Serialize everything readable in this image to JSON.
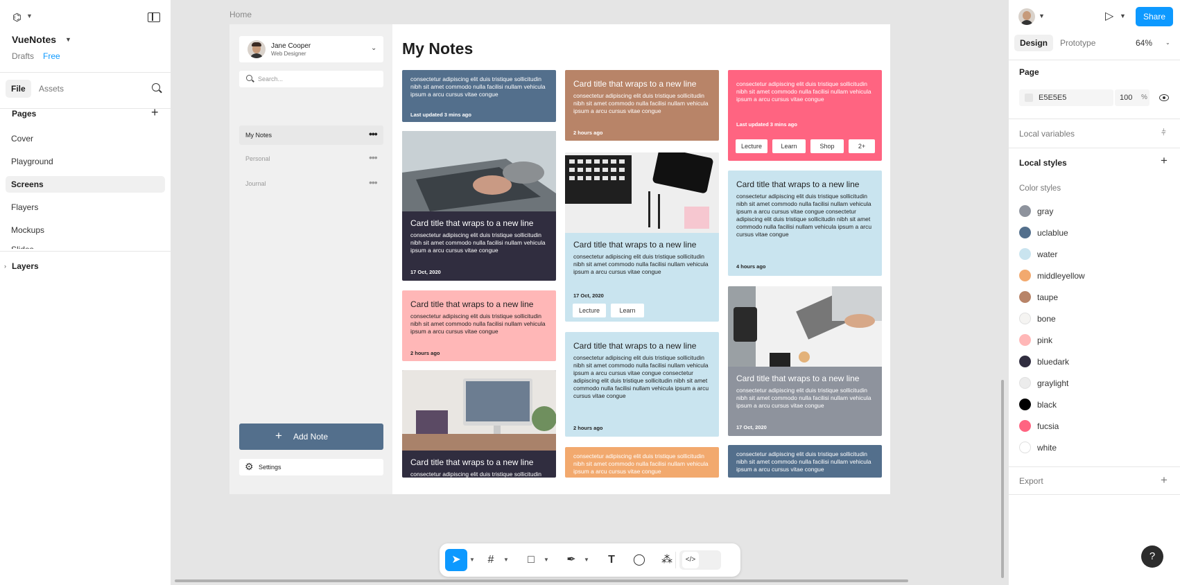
{
  "left_panel": {
    "project_name": "VueNotes",
    "drafts_label": "Drafts",
    "plan_label": "Free",
    "tabs": [
      "File",
      "Assets"
    ],
    "pages_header": "Pages",
    "pages": [
      "Cover",
      "Playground",
      "Screens",
      "Flayers",
      "Mockups"
    ],
    "pages_partial": "Slides",
    "selected_page": "Screens",
    "layers_label": "Layers"
  },
  "canvas": {
    "frame_label": "Home"
  },
  "app": {
    "user_name": "Jane Cooper",
    "user_role": "Web Designer",
    "search_placeholder": "Search...",
    "nav": [
      "My Notes",
      "Personal",
      "Journal"
    ],
    "add_note_label": "Add Note",
    "settings_label": "Settings",
    "title": "My Notes",
    "card_title": "Card title that wraps to a new line",
    "body_short": "consectetur adipiscing elit duis tristique sollicitudin nibh sit amet commodo nulla facilisi nullam vehicula ipsum a arcu cursus vitae congue",
    "body_long": "consectetur adipiscing elit duis tristique sollicitudin nibh sit amet commodo nulla facilisi nullam vehicula ipsum a arcu cursus vitae congue consectetur adipiscing elit duis tristique sollicitudin nibh sit amet commodo nulla facilisi nullam vehicula ipsum a arcu cursus vitae congue",
    "date_updated": "Last updated 3 mins ago",
    "date_2h": "2 hours ago",
    "date_4h": "4 hours ago",
    "date_oct": "17 Oct, 2020",
    "tags_a": [
      "Lecture",
      "Learn",
      "Shop",
      "2+"
    ],
    "tags_b": [
      "Lecture",
      "Learn"
    ]
  },
  "right_panel": {
    "share_label": "Share",
    "tabs": [
      "Design",
      "Prototype"
    ],
    "zoom": "64%",
    "page_header": "Page",
    "page_color_hex": "E5E5E5",
    "page_opacity": "100",
    "page_opacity_unit": "%",
    "local_variables": "Local variables",
    "local_styles": "Local styles",
    "color_styles_header": "Color styles",
    "color_styles": [
      {
        "name": "gray",
        "color": "#8e939d"
      },
      {
        "name": "uclablue",
        "color": "#536f8c"
      },
      {
        "name": "water",
        "color": "#c9e4ef"
      },
      {
        "name": "middleyellow",
        "color": "#f2a96e"
      },
      {
        "name": "taupe",
        "color": "#b88468"
      },
      {
        "name": "bone",
        "color": "#f5f4f2"
      },
      {
        "name": "pink",
        "color": "#ffb7b7"
      },
      {
        "name": "bluedark",
        "color": "#302d3f"
      },
      {
        "name": "graylight",
        "color": "#ececec"
      },
      {
        "name": "black",
        "color": "#000000"
      },
      {
        "name": "fucsia",
        "color": "#ff6481"
      },
      {
        "name": "white",
        "color": "#ffffff"
      }
    ],
    "export_label": "Export",
    "help_label": "?"
  }
}
